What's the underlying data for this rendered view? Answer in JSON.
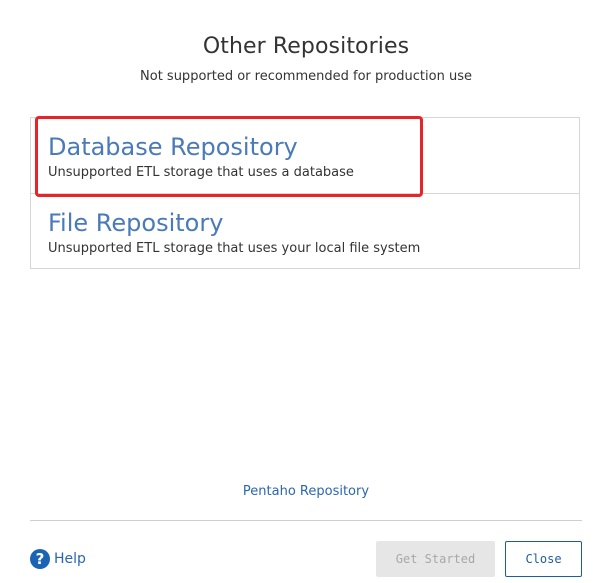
{
  "header": {
    "title": "Other Repositories",
    "subtitle": "Not supported or recommended for production use"
  },
  "repositories": [
    {
      "name": "Database Repository",
      "description": "Unsupported ETL storage that uses a database",
      "highlighted": true
    },
    {
      "name": "File Repository",
      "description": "Unsupported ETL storage that uses your local file system",
      "highlighted": false
    }
  ],
  "links": {
    "pentaho_repository": "Pentaho Repository"
  },
  "footer": {
    "help_icon": "question-circle-icon",
    "help_icon_glyph": "?",
    "help_label": "Help",
    "get_started_label": "Get Started",
    "get_started_disabled": true,
    "close_label": "Close"
  },
  "colors": {
    "link": "#2a66b0",
    "repo_name": "#4a7ab8",
    "highlight": "#e8242a",
    "help_icon_bg": "#1b63b4",
    "close_border": "#1f5c9e",
    "disabled_bg": "#e6e6e6"
  }
}
